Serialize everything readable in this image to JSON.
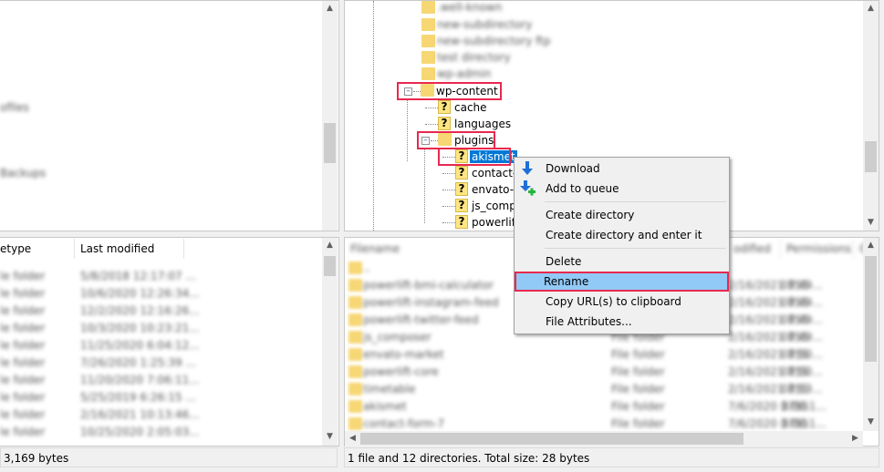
{
  "local": {
    "tree_items": [
      "ofiles",
      "Backups"
    ],
    "columns": [
      "etype",
      "Last modified"
    ],
    "rows": [
      [
        "le folder",
        "5/8/2018 12:17:07 ..."
      ],
      [
        "le folder",
        "10/6/2020 12:26:34..."
      ],
      [
        "le folder",
        "12/2/2020 12:16:26..."
      ],
      [
        "le folder",
        "10/3/2020 10:23:21..."
      ],
      [
        "le folder",
        "11/25/2020 6:04:12..."
      ],
      [
        "le folder",
        "7/26/2020 1:25:39 ..."
      ],
      [
        "le folder",
        "11/20/2020 7:06:11..."
      ],
      [
        "le folder",
        "5/25/2019 6:26:15 ..."
      ],
      [
        "le folder",
        "2/16/2021 10:13:46..."
      ],
      [
        "le folder",
        "10/25/2020 2:05:03..."
      ]
    ],
    "status": "3,169 bytes"
  },
  "remote": {
    "tree_blurred": [
      ".well-known",
      "new-subdirectory",
      "new-subdirectory ftp",
      "test directory",
      "wp-admin"
    ],
    "tree": {
      "wp_content": "wp-content",
      "cache": "cache",
      "languages": "languages",
      "plugins": "plugins",
      "plugin_children": [
        "akismet",
        "contact-f",
        "envato-m",
        "js_compo",
        "powerlift"
      ]
    },
    "columns": [
      "Filename",
      "odified",
      "Permissions",
      "O"
    ],
    "rows": [
      [
        "..",
        "",
        "",
        ""
      ],
      [
        "powerlift-bmi-calculator",
        "",
        "2/16/2021 8:49...",
        "0755"
      ],
      [
        "powerlift-instagram-feed",
        "",
        "2/16/2021 8:49...",
        "0755"
      ],
      [
        "powerlift-twitter-feed",
        "",
        "2/16/2021 8:49...",
        "0755"
      ],
      [
        "js_composer",
        "File folder",
        "2/16/2021 8:49...",
        "0755"
      ],
      [
        "envato-market",
        "File folder",
        "2/16/2021 8:50...",
        "0755"
      ],
      [
        "powerlift-core",
        "File folder",
        "2/16/2021 8:50...",
        "0755"
      ],
      [
        "timetable",
        "File folder",
        "2/16/2021 8:53...",
        "0755"
      ],
      [
        "akismet",
        "File folder",
        "7/6/2020 3:06:1...",
        "0755"
      ],
      [
        "contact-form-7",
        "File folder",
        "7/6/2020 3:06:1...",
        "0755"
      ]
    ],
    "status": "1 file and 12 directories. Total size: 28 bytes"
  },
  "context_menu": {
    "items": [
      "Download",
      "Add to queue",
      "Create directory",
      "Create directory and enter it",
      "Delete",
      "Rename",
      "Copy URL(s) to clipboard",
      "File Attributes..."
    ],
    "highlighted": "Rename"
  },
  "colors": {
    "highlight_border": "#e8294f",
    "selection": "#0078d7",
    "menu_hover": "#91c9f7",
    "icon_blue": "#1e6fd9",
    "icon_green": "#27b43e"
  }
}
